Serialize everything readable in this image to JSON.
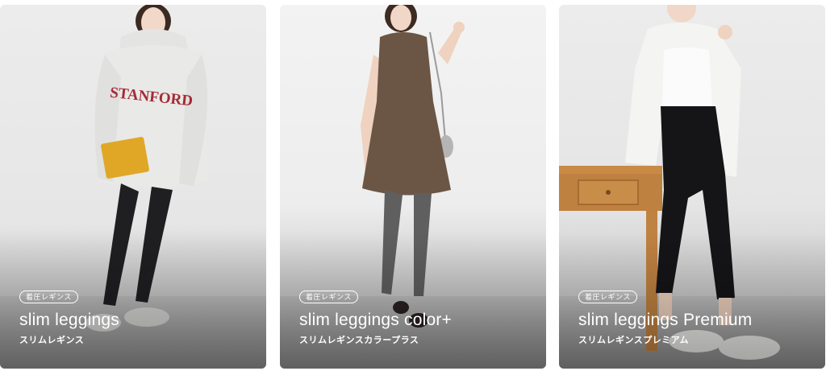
{
  "products": [
    {
      "badge": "着圧レギンス",
      "title": "slim leggings",
      "subtitle": "スリムレギンス",
      "hoodie_text": "STANFORD"
    },
    {
      "badge": "着圧レギンス",
      "title": "slim leggings color+",
      "subtitle": "スリムレギンスカラープラス"
    },
    {
      "badge": "着圧レギンス",
      "title": "slim leggings Premium",
      "subtitle": "スリムレギンスプレミアム"
    }
  ],
  "colors": {
    "card_1_legging": "#1f1f22",
    "card_2_legging": "#5f5f60",
    "card_3_legging": "#151518",
    "hoodie": "#e9e9e7",
    "hoodie_text": "#a52a35",
    "clutch": "#e0a726",
    "dress": "#6b5646",
    "shirt": "#f4f4f2",
    "desk": "#c88a45"
  }
}
